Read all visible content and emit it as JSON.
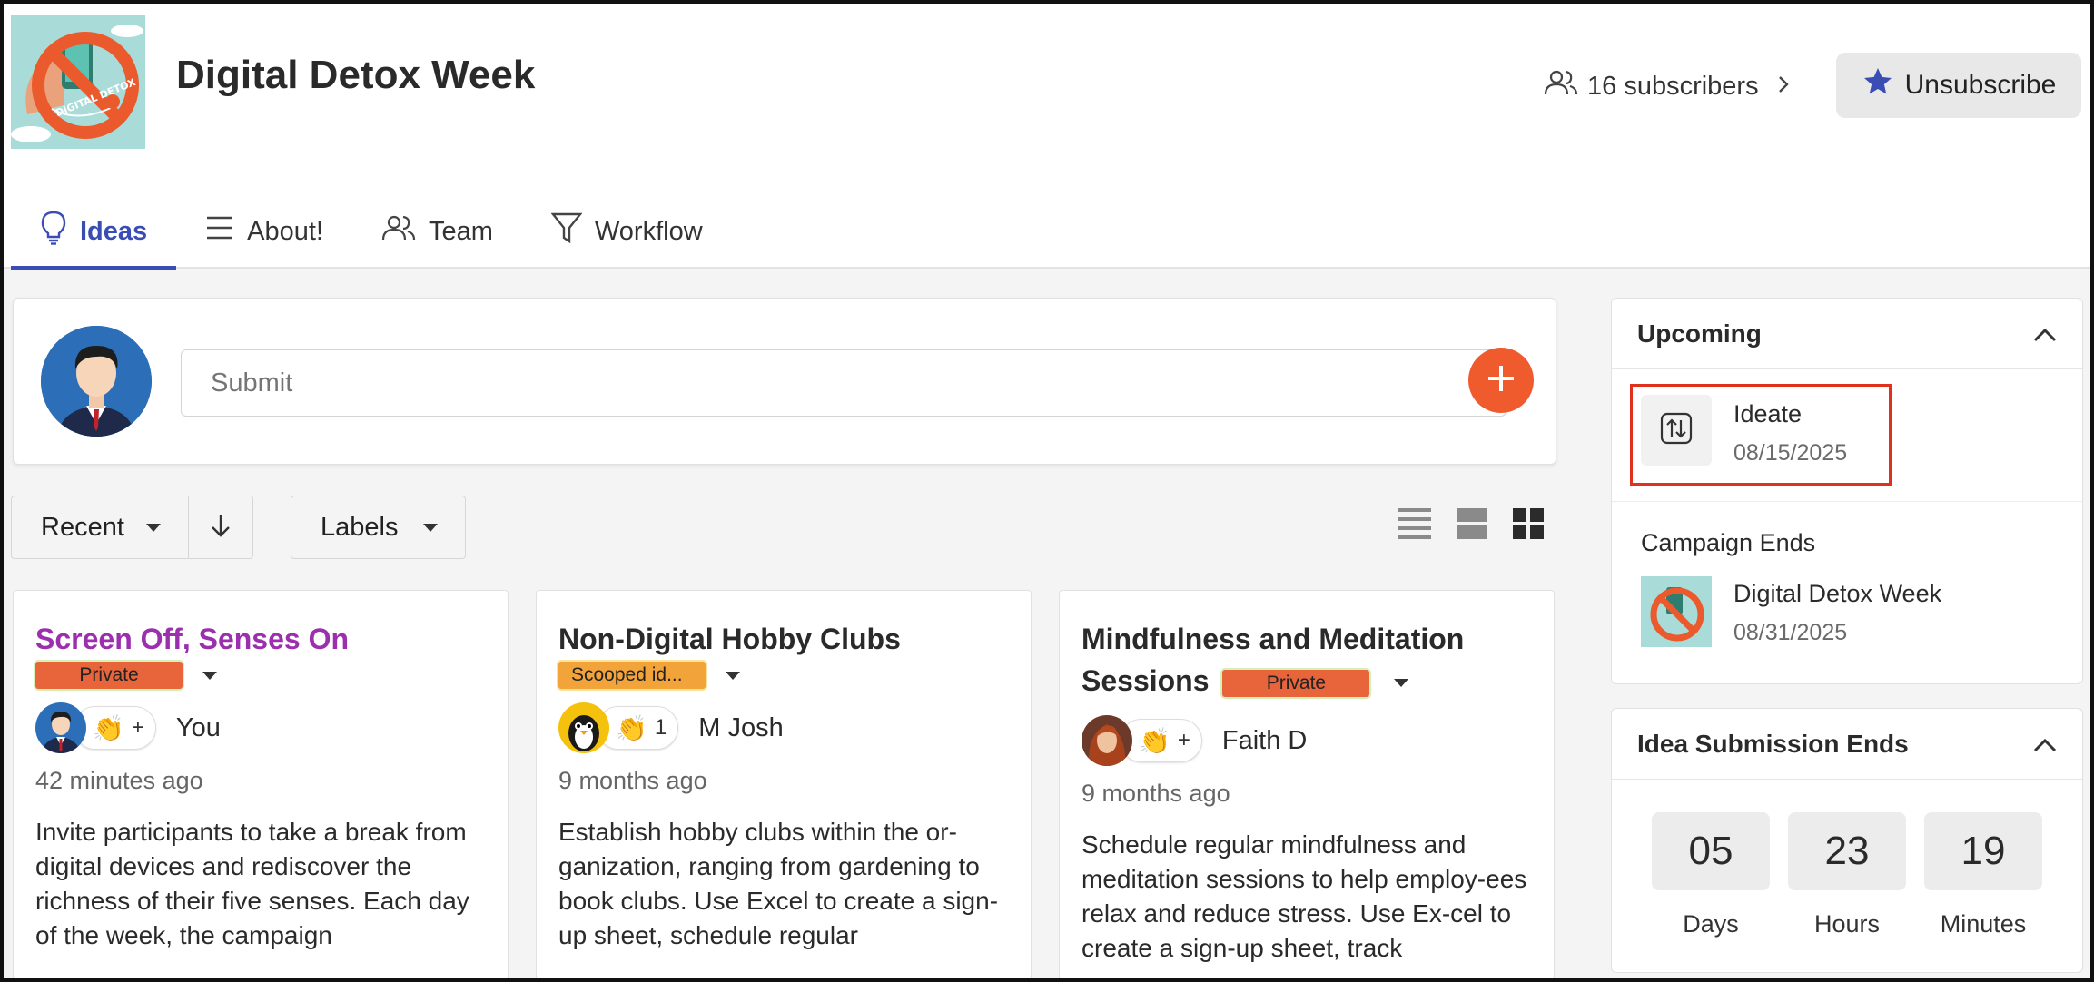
{
  "header": {
    "title": "Digital Detox Week",
    "subscribers_label": "16 subscribers",
    "unsubscribe_label": "Unsubscribe"
  },
  "tabs": [
    {
      "label": "Ideas",
      "icon": "lightbulb-icon",
      "active": true
    },
    {
      "label": "About!",
      "icon": "menu-lines-icon",
      "active": false
    },
    {
      "label": "Team",
      "icon": "users-icon",
      "active": false
    },
    {
      "label": "Workflow",
      "icon": "funnel-icon",
      "active": false
    }
  ],
  "submit": {
    "placeholder": "Submit"
  },
  "controls": {
    "sort_label": "Recent",
    "labels_label": "Labels"
  },
  "ideas": [
    {
      "title": "Screen Off, Senses On",
      "badge": "Private",
      "claps": "+",
      "author": "You",
      "time": "42 minutes ago",
      "description": "Invite participants to take a break from digital devices and rediscover the richness of their five senses. Each day of the week, the campaign"
    },
    {
      "title": "Non-Digital Hobby Clubs",
      "badge": "Scooped id...",
      "claps": "1",
      "author": "M Josh",
      "time": "9 months ago",
      "description": "Establish hobby clubs within the or-ganization, ranging from gardening to book clubs. Use Excel to create a sign-up sheet, schedule regular"
    },
    {
      "title": "Mindfulness and Meditation Sessions",
      "badge": "Private",
      "claps": "+",
      "author": "Faith D",
      "time": "9 months ago",
      "description": "Schedule regular mindfulness and meditation sessions to help employ-ees relax and reduce stress. Use Ex-cel to create a sign-up sheet, track"
    }
  ],
  "sidebar": {
    "upcoming": {
      "title": "Upcoming",
      "event": {
        "title": "Ideate",
        "date": "08/15/2025"
      },
      "campaign_label": "Campaign Ends",
      "campaign": {
        "title": "Digital Detox Week",
        "date": "08/31/2025"
      }
    },
    "submission": {
      "title": "Idea Submission Ends",
      "countdown": [
        {
          "value": "05",
          "label": "Days"
        },
        {
          "value": "23",
          "label": "Hours"
        },
        {
          "value": "19",
          "label": "Minutes"
        }
      ]
    }
  },
  "colors": {
    "accent": "#3a4db5",
    "add_button": "#ef5b2d",
    "private_badge": "#e8643b",
    "scooped_badge": "#f2a43a",
    "purple_title": "#9b2fae",
    "highlight": "#e0301e"
  }
}
